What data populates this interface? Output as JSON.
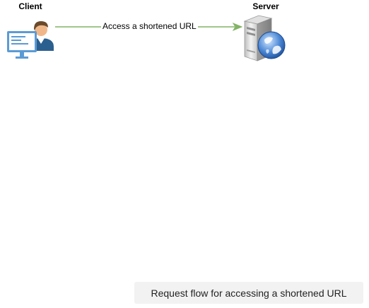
{
  "diagram": {
    "client_label": "Client",
    "server_label": "Server",
    "edge_label": "Access a shortened URL",
    "caption": "Request flow for accessing a shortened URL"
  },
  "colors": {
    "arrow": "#82b366",
    "caption_bg": "#f2f2f2"
  },
  "icons": {
    "client": "user-at-computer-icon",
    "server": "web-server-globe-icon"
  }
}
